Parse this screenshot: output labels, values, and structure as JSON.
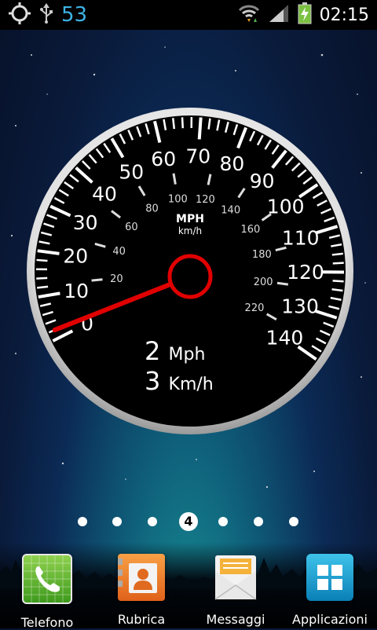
{
  "status_bar": {
    "number": "53",
    "time": "02:15",
    "icons": [
      "gps-icon",
      "usb-icon",
      "wifi-icon",
      "signal-icon",
      "battery-charging-icon"
    ]
  },
  "speedometer": {
    "unit_top": "MPH",
    "unit_bottom": "km/h",
    "mph_labels": [
      "0",
      "10",
      "20",
      "30",
      "40",
      "50",
      "60",
      "70",
      "80",
      "90",
      "100",
      "110",
      "120",
      "130",
      "140"
    ],
    "kmh_labels": [
      "20",
      "40",
      "60",
      "80",
      "100",
      "120",
      "140",
      "160",
      "180",
      "200",
      "220"
    ],
    "speed_mph_value": "2",
    "speed_mph_unit": "Mph",
    "speed_kmh_value": "3",
    "speed_kmh_unit": "Km/h",
    "needle_mph": 2,
    "needle_color": "#e00000"
  },
  "page_indicator": {
    "current": "4"
  },
  "dock": {
    "apps": [
      {
        "label": "Telefono",
        "icon": "phone-icon"
      },
      {
        "label": "Rubrica",
        "icon": "contacts-icon"
      },
      {
        "label": "Messaggi",
        "icon": "messages-icon"
      },
      {
        "label": "Applicazioni",
        "icon": "apps-grid-icon"
      }
    ]
  }
}
